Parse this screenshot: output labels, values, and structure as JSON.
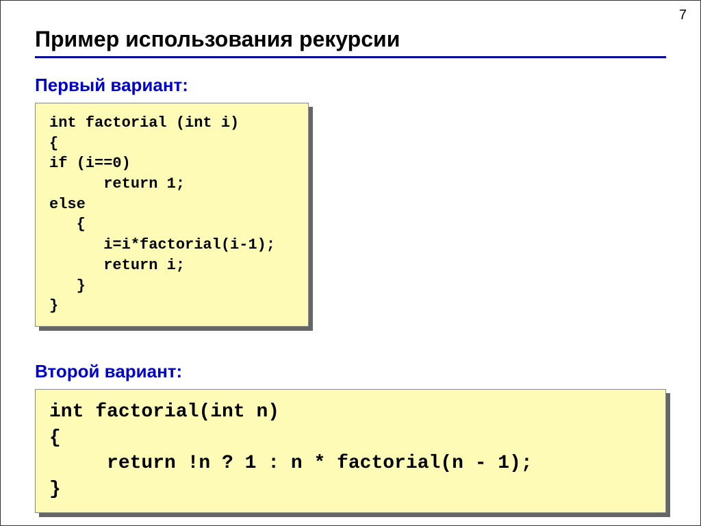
{
  "page_number": "7",
  "title": "Пример использования рекурсии",
  "section1": {
    "heading": "Первый вариант:",
    "code": "int factorial (int i)\n{\nif (i==0)\n      return 1;\nelse\n   {\n      i=i*factorial(i-1);\n      return i;\n   }\n}"
  },
  "section2": {
    "heading": "Второй вариант:",
    "code": "int factorial(int n)\n{\n     return !n ? 1 : n * factorial(n - 1);\n}"
  }
}
